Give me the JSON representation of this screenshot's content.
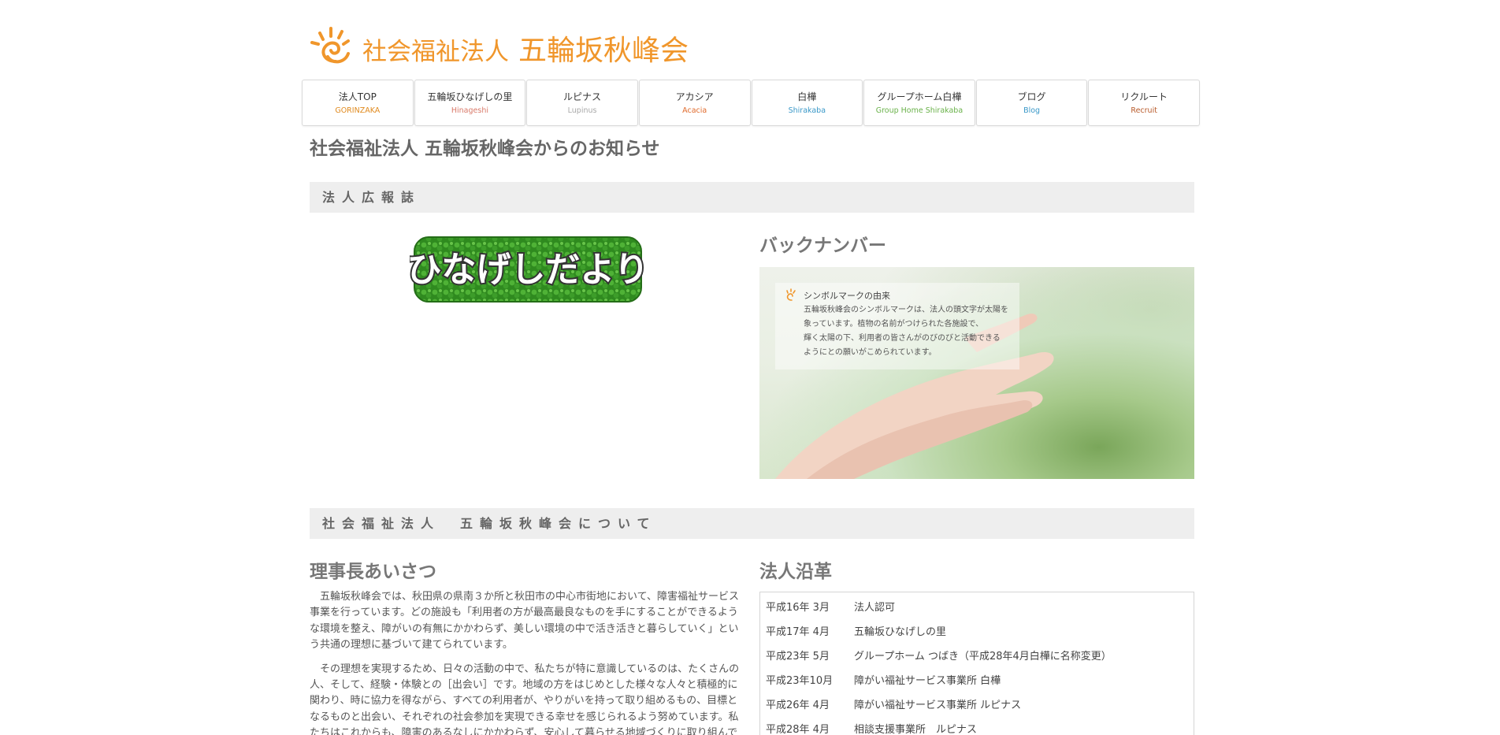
{
  "header": {
    "logo_small": "社会福祉法人",
    "logo_main": "五輪坂秋峰会",
    "brand_color": "#f0962b"
  },
  "nav": [
    {
      "label": "法人TOP",
      "sub": "GORINZAKA",
      "color": "#e08a1e"
    },
    {
      "label": "五輪坂ひなげしの里",
      "sub": "Hinageshi",
      "color": "#d97a6a"
    },
    {
      "label": "ルピナス",
      "sub": "Lupinus",
      "color": "#a8a8a8"
    },
    {
      "label": "アカシア",
      "sub": "Acacia",
      "color": "#e06a2b"
    },
    {
      "label": "白樺",
      "sub": "Shirakaba",
      "color": "#3a98c8"
    },
    {
      "label": "グループホーム白樺",
      "sub": "Group Home Shirakaba",
      "color": "#6ab24a"
    },
    {
      "label": "ブログ",
      "sub": "Blog",
      "color": "#3a98c8"
    },
    {
      "label": "リクルート",
      "sub": "Recruit",
      "color": "#b85a2a"
    }
  ],
  "page_title": "社会福祉法人 五輪坂秋峰会からのお知らせ",
  "section_pr": "法人広報誌",
  "hinageshi_banner": "ひなげしだより",
  "back_number": {
    "title": "バックナンバー",
    "symbol_title": "シンボルマークの由来",
    "symbol_lines": [
      "五輪坂秋峰会のシンボルマークは、法人の頭文字が太陽を",
      "象っています。植物の名前がつけられた各施設で、",
      "輝く太陽の下、利用者の皆さんがのびのびと活動できる",
      "ようにとの願いがこめられています。"
    ]
  },
  "section_about": "社会福祉法人　五輪坂秋峰会について",
  "greeting": {
    "title": "理事長あいさつ",
    "paragraphs": [
      "五輪坂秋峰会では、秋田県の県南３か所と秋田市の中心市街地において、障害福祉サービス事業を行っています。どの施設も「利用者の方が最高最良なものを手にすることができるような環境を整え、障がいの有無にかかわらず、美しい環境の中で活き活きと暮らしていく」という共通の理想に基づいて建てられています。",
      "その理想を実現するため、日々の活動の中で、私たちが特に意識しているのは、たくさんの人、そして、経験・体験との［出会い］です。地域の方をはじめとした様々な人々と積極的に関わり、時に協力を得ながら、すべての利用者が、やりがいを持って取り組めるもの、目標となるものと出会い、それぞれの社会参加を実現できる幸せを感じられるよう努めています。私たちはこれからも、障害のあるなしにかかわらず、安心して暮らせる地域づくりに取り組んでまいります。"
    ]
  },
  "history": {
    "title": "法人沿革",
    "rows": [
      {
        "date": "平成16年 3月",
        "event": "法人認可"
      },
      {
        "date": "平成17年 4月",
        "event": "五輪坂ひなげしの里"
      },
      {
        "date": "平成23年 5月",
        "event": "グループホーム つばき（平成28年4月白樺に名称変更）"
      },
      {
        "date": "平成23年10月",
        "event": "障がい福祉サービス事業所 白樺"
      },
      {
        "date": "平成26年 4月",
        "event": "障がい福祉サービス事業所 ルピナス"
      },
      {
        "date": "平成28年 4月",
        "event": "相談支援事業所　ルピナス"
      }
    ]
  }
}
